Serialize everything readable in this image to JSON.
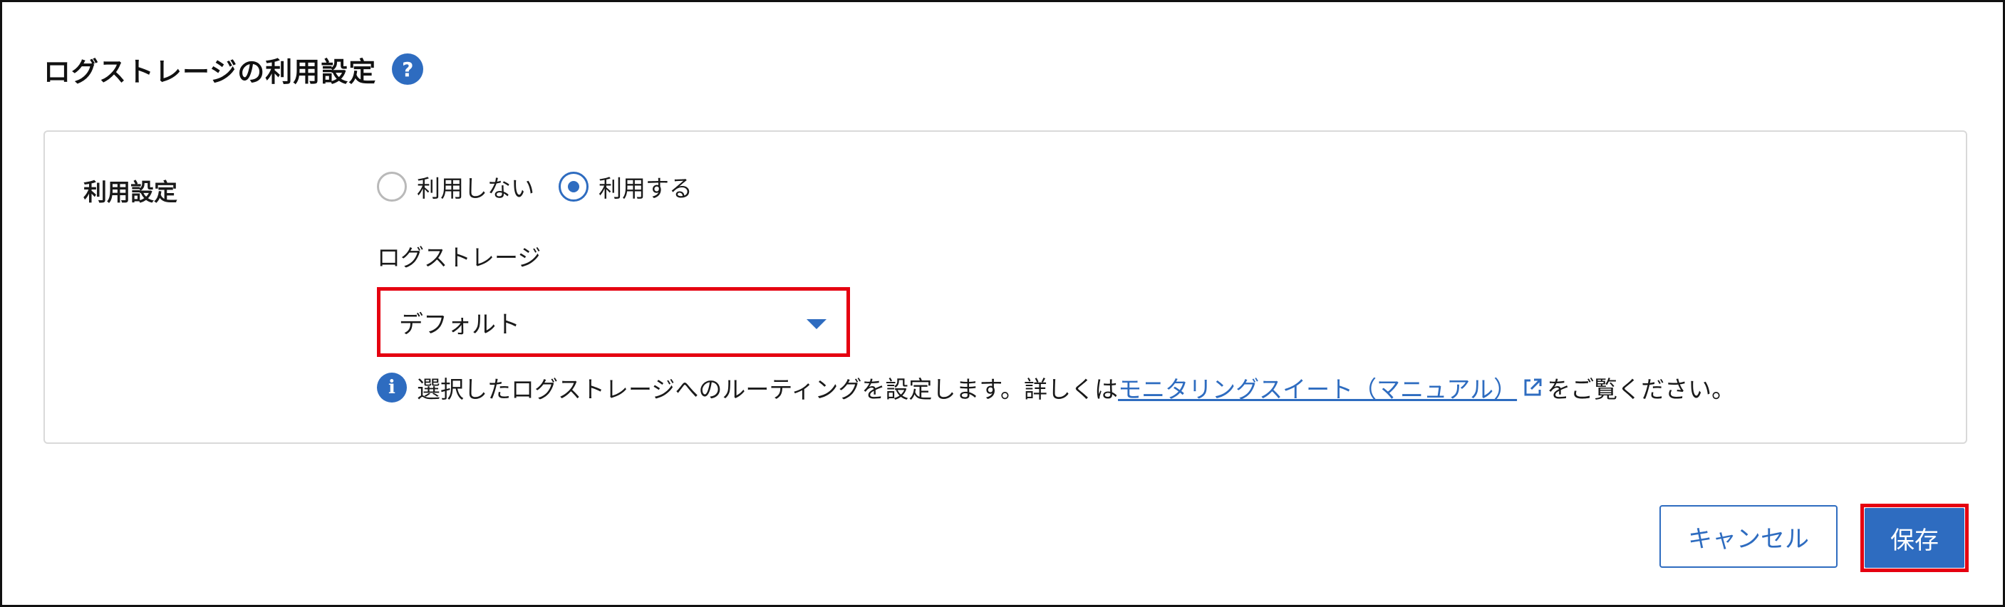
{
  "header": {
    "title": "ログストレージの利用設定",
    "help_icon": "?"
  },
  "settings": {
    "field_label": "利用設定",
    "radio_options": [
      {
        "label": "利用しない",
        "checked": false
      },
      {
        "label": "利用する",
        "checked": true
      }
    ],
    "storage_label": "ログストレージ",
    "storage_select": {
      "value": "デフォルト",
      "icon": "caret-down-icon"
    },
    "info": {
      "icon_glyph": "i",
      "text_before": "選択したログストレージへのルーティングを設定します。詳しくは",
      "link_text": "モニタリングスイート（マニュアル）",
      "text_after": "をご覧ください。",
      "link_icon": "external-link-icon"
    }
  },
  "footer": {
    "cancel_label": "キャンセル",
    "save_label": "保存"
  },
  "colors": {
    "accent": "#2e6cc0",
    "highlight": "#e50010",
    "border": "#d9d9d9"
  }
}
